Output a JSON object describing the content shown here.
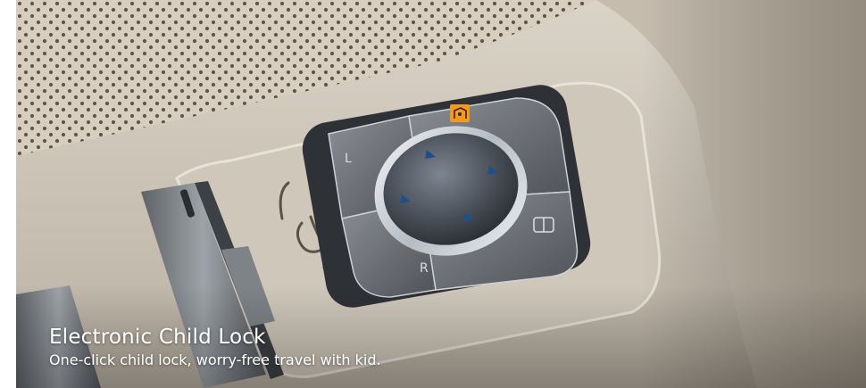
{
  "feature": {
    "title": "Electronic Child Lock",
    "description": "One-click child lock, worry-free travel with kid."
  },
  "controls": {
    "mirror_left_label": "L",
    "mirror_right_label": "R"
  },
  "colors": {
    "child_lock_indicator": "#f39a1e",
    "trim_base": "#c9c0b2",
    "chrome": "#d9dde2"
  }
}
